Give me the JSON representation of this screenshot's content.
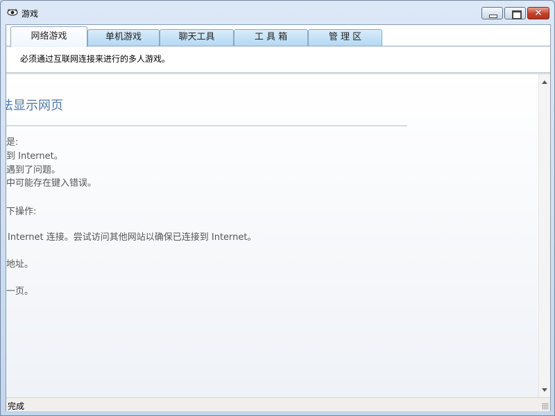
{
  "window": {
    "title": "游戏"
  },
  "tabs": [
    {
      "label": "网络游戏",
      "active": true
    },
    {
      "label": "单机游戏",
      "active": false
    },
    {
      "label": "聊天工具",
      "active": false
    },
    {
      "label": "工 具 箱",
      "active": false
    },
    {
      "label": "管 理 区",
      "active": false
    }
  ],
  "description": "必须通过互联网连接来进行的多人游戏。",
  "error_page": {
    "title": "法显示网页",
    "lines": [
      "是:",
      "到 Internet。",
      "遇到了问题。",
      "中可能存在键入错误。",
      "下操作:",
      "Internet 连接。尝试访问其他网站以确保已连接到 Internet。",
      "地址。",
      "一页。"
    ]
  },
  "status": {
    "text": "完成"
  },
  "colors": {
    "link_blue": "#4f79a9",
    "close_red": "#c6402a",
    "tab_blue": "#b5d8f2"
  }
}
